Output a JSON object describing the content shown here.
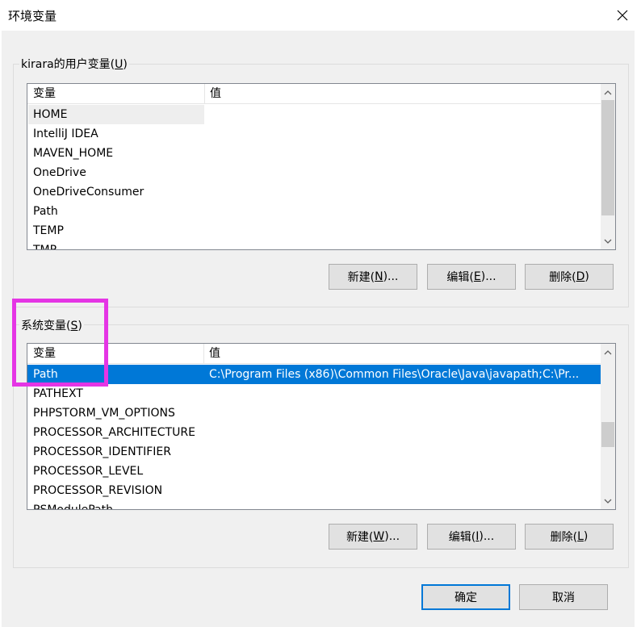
{
  "window": {
    "title": "环境变量",
    "close_icon": "close-icon"
  },
  "user_vars": {
    "group_title_pre": "kirara的用户变量(",
    "group_title_key": "U",
    "group_title_post": ")",
    "columns": [
      "变量",
      "值"
    ],
    "rows": [
      {
        "name": "HOME",
        "value": ""
      },
      {
        "name": "IntelliJ IDEA",
        "value": ""
      },
      {
        "name": "MAVEN_HOME",
        "value": ""
      },
      {
        "name": "OneDrive",
        "value": ""
      },
      {
        "name": "OneDriveConsumer",
        "value": ""
      },
      {
        "name": "Path",
        "value": ""
      },
      {
        "name": "TEMP",
        "value": ""
      },
      {
        "name": "TMP",
        "value": ""
      }
    ],
    "buttons": {
      "new": {
        "pre": "新建(",
        "key": "N",
        "post": ")..."
      },
      "edit": {
        "pre": "编辑(",
        "key": "E",
        "post": ")..."
      },
      "delete": {
        "pre": "删除(",
        "key": "D",
        "post": ")"
      }
    }
  },
  "system_vars": {
    "group_title_pre": "系统变量(",
    "group_title_key": "S",
    "group_title_post": ")",
    "columns": [
      "变量",
      "值"
    ],
    "rows": [
      {
        "name": "Path",
        "value": "C:\\Program Files (x86)\\Common Files\\Oracle\\Java\\javapath;C:\\Pr...",
        "selected": true
      },
      {
        "name": "PATHEXT",
        "value": ""
      },
      {
        "name": "PHPSTORM_VM_OPTIONS",
        "value": ""
      },
      {
        "name": "PROCESSOR_ARCHITECTURE",
        "value": ""
      },
      {
        "name": "PROCESSOR_IDENTIFIER",
        "value": ""
      },
      {
        "name": "PROCESSOR_LEVEL",
        "value": ""
      },
      {
        "name": "PROCESSOR_REVISION",
        "value": ""
      },
      {
        "name": "PSModulePath",
        "value": ""
      }
    ],
    "buttons": {
      "new": {
        "pre": "新建(",
        "key": "W",
        "post": ")..."
      },
      "edit": {
        "pre": "编辑(",
        "key": "I",
        "post": ")..."
      },
      "delete": {
        "pre": "删除(",
        "key": "L",
        "post": ")"
      }
    }
  },
  "footer": {
    "ok": "确定",
    "cancel": "取消"
  },
  "colors": {
    "selection": "#0078d7",
    "highlight_box": "#e535e5"
  }
}
